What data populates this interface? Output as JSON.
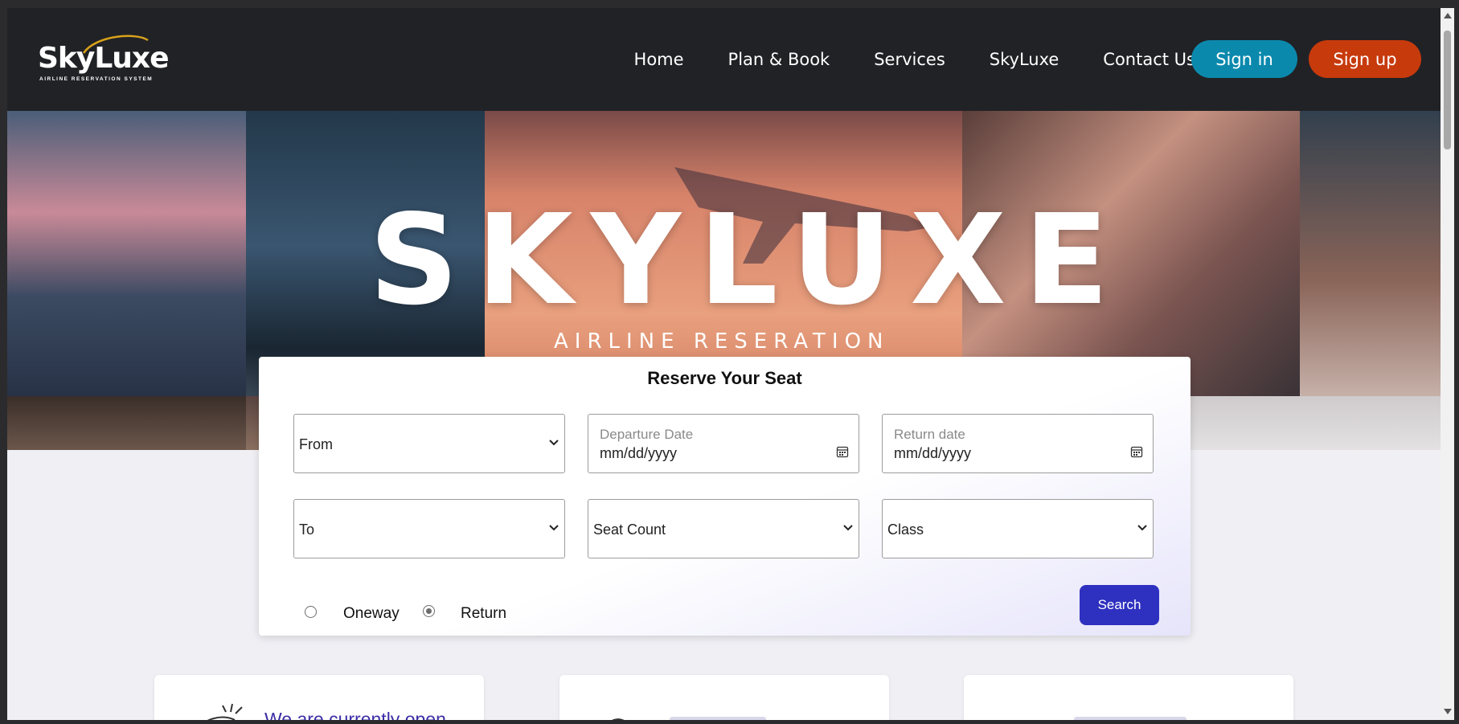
{
  "brand": {
    "logo_text": "SkyLuxe",
    "logo_tagline": "AIRLINE   RESERVATION   SYSTEM"
  },
  "nav": {
    "links": [
      {
        "label": "Home"
      },
      {
        "label": "Plan & Book"
      },
      {
        "label": "Services"
      },
      {
        "label": "SkyLuxe"
      },
      {
        "label": "Contact Us"
      }
    ],
    "signin_label": "Sign in",
    "signup_label": "Sign up"
  },
  "hero": {
    "title": "SKYLUXE",
    "subtitle": "AIRLINE RESERATION"
  },
  "reservation": {
    "title": "Reserve Your Seat",
    "from": {
      "value": "From"
    },
    "to": {
      "value": "To"
    },
    "departure": {
      "label": "Departure Date",
      "placeholder": "mm/dd/yyyy"
    },
    "return": {
      "label": "Return date",
      "placeholder": "mm/dd/yyyy"
    },
    "seat_count": {
      "value": "Seat Count"
    },
    "class": {
      "value": "Class"
    },
    "trip_types": [
      {
        "label": "Oneway",
        "selected": false
      },
      {
        "label": "Return",
        "selected": true
      }
    ],
    "search_label": "Search"
  },
  "info_cards": [
    {
      "text": "We are currently open",
      "icon": "sun-icon"
    },
    {
      "text": "",
      "icon": "flight-icon"
    },
    {
      "text": "",
      "icon": "refund-icon"
    }
  ],
  "colors": {
    "navbar_bg": "#212226",
    "signin_bg": "#0b89ad",
    "signup_bg": "#c73a0c",
    "search_bg": "#2e30c0",
    "page_bg": "#efeff4",
    "info_text": "#3b2ea6"
  }
}
